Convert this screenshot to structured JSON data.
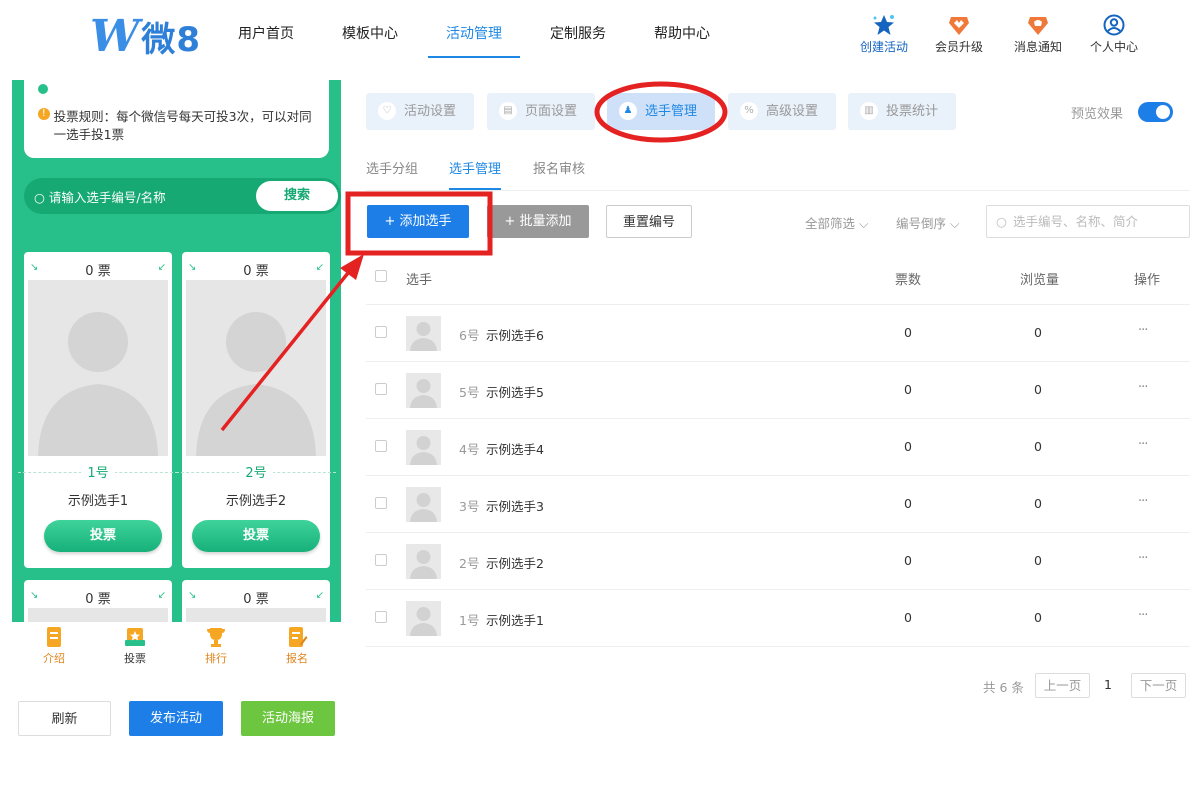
{
  "logo": {
    "mark": "W",
    "text": "微8"
  },
  "nav": [
    {
      "label": "用户首页"
    },
    {
      "label": "模板中心"
    },
    {
      "label": "活动管理"
    },
    {
      "label": "定制服务"
    },
    {
      "label": "帮助中心"
    }
  ],
  "tools": [
    {
      "label": "创建活动",
      "icon": "star-icon"
    },
    {
      "label": "会员升级",
      "icon": "crown-icon"
    },
    {
      "label": "消息通知",
      "icon": "bell-icon"
    },
    {
      "label": "个人中心",
      "icon": "user-icon"
    }
  ],
  "phone": {
    "rules_text": "投票规则：每个微信号每天可投3次，可以对同一选手投1票",
    "search_placeholder": "请输入选手编号/名称",
    "search_button": "搜索",
    "cards": [
      {
        "votes": "0 票",
        "number": "1号",
        "name": "示例选手1",
        "vote_label": "投票"
      },
      {
        "votes": "0 票",
        "number": "2号",
        "name": "示例选手2",
        "vote_label": "投票"
      },
      {
        "votes": "0 票"
      },
      {
        "votes": "0 票"
      }
    ],
    "tabs": [
      {
        "label": "介绍",
        "icon": "intro-icon"
      },
      {
        "label": "投票",
        "icon": "vote-icon"
      },
      {
        "label": "排行",
        "icon": "trophy-icon"
      },
      {
        "label": "报名",
        "icon": "signup-icon"
      }
    ]
  },
  "bottom_buttons": {
    "refresh": "刷新",
    "publish": "发布活动",
    "poster": "活动海报"
  },
  "settings_tabs": [
    {
      "label": "活动设置",
      "icon": "heart-icon"
    },
    {
      "label": "页面设置",
      "icon": "page-icon"
    },
    {
      "label": "选手管理",
      "icon": "contestant-icon"
    },
    {
      "label": "高级设置",
      "icon": "percent-icon"
    },
    {
      "label": "投票统计",
      "icon": "stats-icon"
    }
  ],
  "preview_label": "预览效果",
  "sub_tabs": [
    {
      "label": "选手分组"
    },
    {
      "label": "选手管理"
    },
    {
      "label": "报名审核"
    }
  ],
  "toolbar": {
    "add": "+ 添加选手",
    "batch_add": "+ 批量添加",
    "renumber": "重置编号",
    "filter_all": "全部筛选",
    "sort": "编号倒序",
    "search_placeholder": "选手编号、名称、简介"
  },
  "table": {
    "headers": {
      "contestant": "选手",
      "votes": "票数",
      "views": "浏览量",
      "actions": "操作"
    },
    "rows": [
      {
        "number": "6号",
        "name": "示例选手6",
        "votes": "0",
        "views": "0",
        "more": "···"
      },
      {
        "number": "5号",
        "name": "示例选手5",
        "votes": "0",
        "views": "0",
        "more": "···"
      },
      {
        "number": "4号",
        "name": "示例选手4",
        "votes": "0",
        "views": "0",
        "more": "···"
      },
      {
        "number": "3号",
        "name": "示例选手3",
        "votes": "0",
        "views": "0",
        "more": "···"
      },
      {
        "number": "2号",
        "name": "示例选手2",
        "votes": "0",
        "views": "0",
        "more": "···"
      },
      {
        "number": "1号",
        "name": "示例选手1",
        "votes": "0",
        "views": "0",
        "more": "···"
      }
    ]
  },
  "pagination": {
    "total": "共 6 条",
    "prev": "上一页",
    "current": "1",
    "next": "下一页"
  },
  "colors": {
    "accent": "#1e88e5",
    "green": "#27c08a",
    "annotation_red": "#e52222"
  }
}
